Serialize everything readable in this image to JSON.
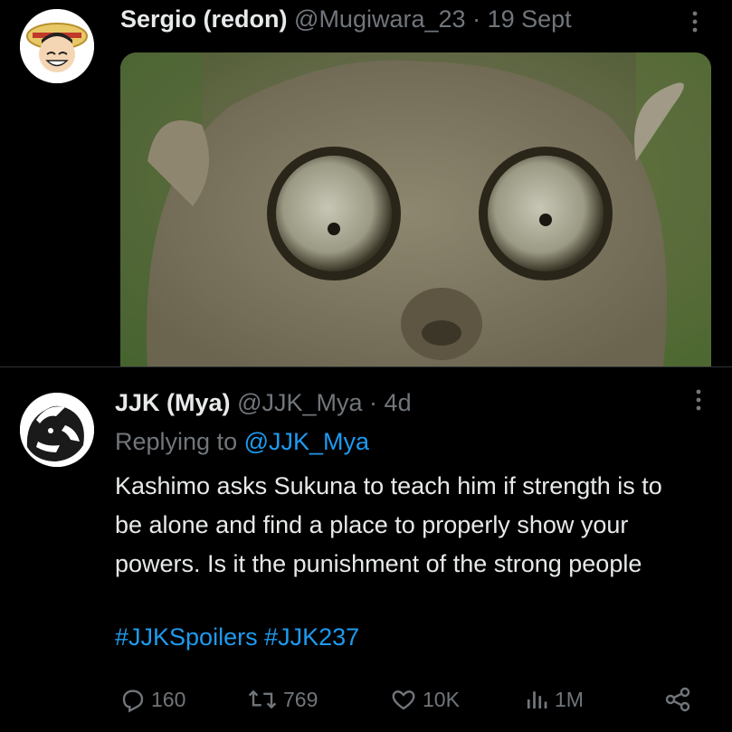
{
  "tweet_top": {
    "display_name": "Sergio (redon)",
    "handle": "@Mugiwara_23",
    "separator": "·",
    "date": "19 Sept"
  },
  "tweet_reply": {
    "display_name": "JJK (Mya)",
    "handle": "@JJK_Mya",
    "separator": "·",
    "age": "4d",
    "replying_prefix": "Replying to",
    "replying_handle": "@JJK_Mya",
    "text": "Kashimo asks Sukuna to teach him if strength is to be alone and find a place to properly show your powers. Is it the punishment of the strong people",
    "hashtags": "#JJKSpoilers #JJK237",
    "stats": {
      "replies": "160",
      "retweets": "769",
      "likes": "10K",
      "views": "1M"
    }
  },
  "colors": {
    "background": "#000000",
    "text": "#e7e9ea",
    "muted": "#71767b",
    "link": "#1d9bf0"
  },
  "icons": [
    "more-icon",
    "reply-icon",
    "retweet-icon",
    "like-icon",
    "views-icon",
    "share-icon"
  ]
}
